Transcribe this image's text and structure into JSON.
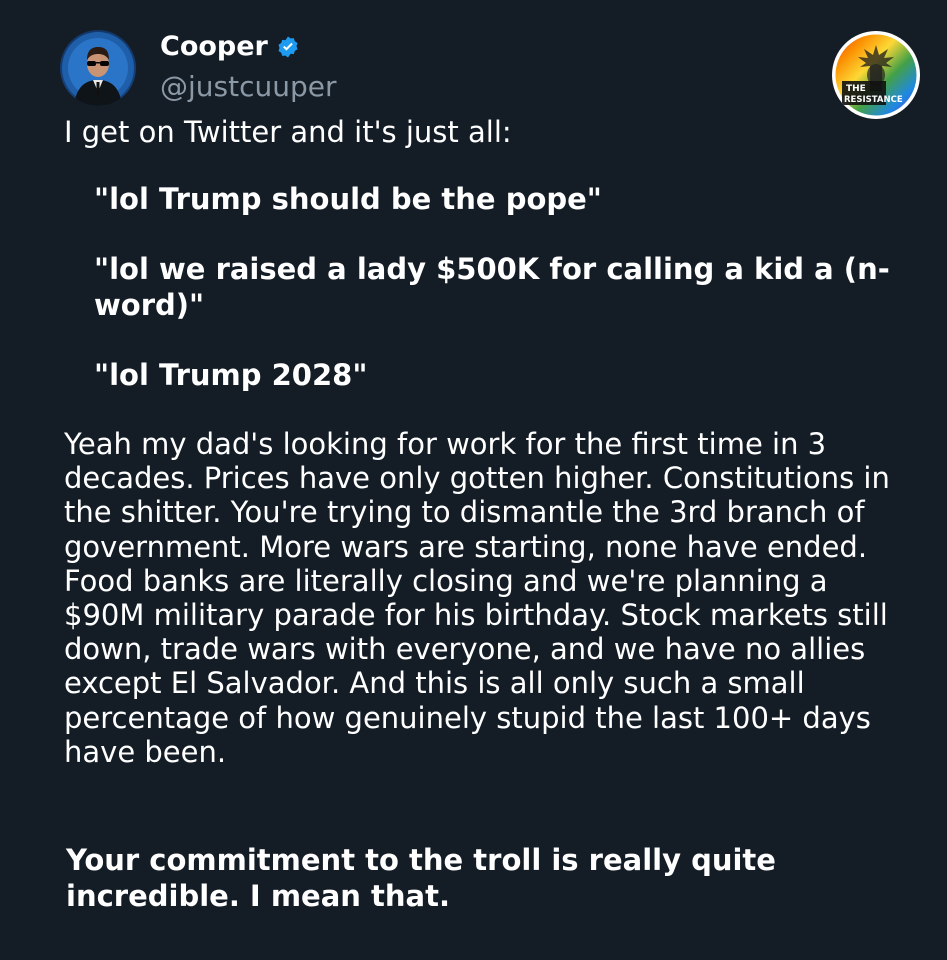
{
  "tweet": {
    "author": {
      "display_name": "Cooper",
      "handle": "@justcuuper",
      "verified": true,
      "avatar_icon": "avatar-man-sunglasses",
      "verified_color": "#1d9bf0"
    },
    "badge": {
      "icon": "the-resistance-logo",
      "text_line1": "THE",
      "text_line2": "RESISTANCE"
    },
    "intro": "I get on Twitter and it's just all:",
    "quotes": [
      "\"lol Trump should be the pope\"",
      "\"lol we raised a lady $500K for calling a kid a (n-word)\"",
      "\"lol Trump 2028\""
    ],
    "body": "Yeah my dad's looking for work for the first time in 3 decades. Prices have only gotten higher. Constitutions in the shitter. You're trying to dismantle the 3rd branch of government. More wars are starting, none have ended. Food banks are literally closing and we're planning a $90M military parade for his birthday. Stock markets still down, trade wars with everyone, and we have no allies except El Salvador. And this is all only such a small percentage of how genuinely stupid the last 100+ days have been.",
    "closing": "Your commitment to the troll is really quite incredible. I mean that."
  },
  "colors": {
    "background": "#141d26",
    "text": "#ffffff",
    "handle": "#8b98a5"
  }
}
